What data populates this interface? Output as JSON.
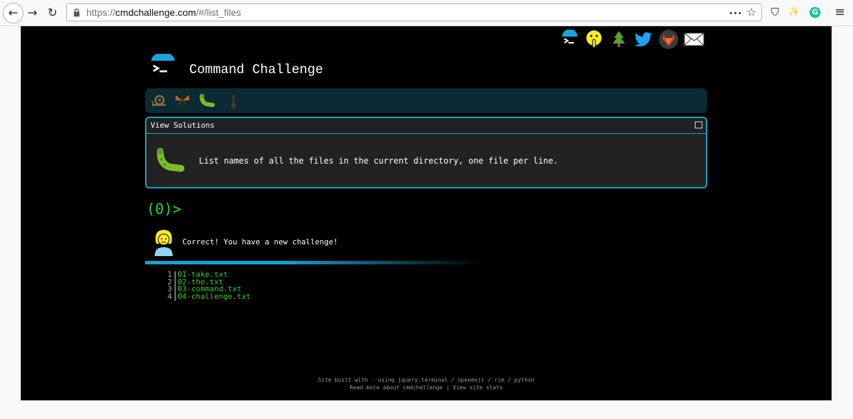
{
  "browser": {
    "url_prefix": "https://",
    "url_domain": "cmdchallenge.com",
    "url_path": "/#/list_files",
    "back_glyph": "←",
    "forward_glyph": "→",
    "reload_glyph": "↻",
    "more_glyph": "•••",
    "bookmark_glyph": "☆",
    "shield_glyph": "⛉",
    "wand_glyph": "✨",
    "grammarly_glyph": "G",
    "menu_glyph": "≡"
  },
  "header": {
    "title": "Command Challenge"
  },
  "level_icons": [
    "snail-icon",
    "butterfly-icon",
    "caterpillar-icon",
    "ant-icon"
  ],
  "panel": {
    "title": "View Solutions",
    "challenge_text": "List names of all the files in the current directory, one file per line."
  },
  "terminal": {
    "prompt": "(0)>",
    "message": "Correct! You have a new challenge!",
    "progress_fraction": 0.42,
    "output": [
      {
        "num": "1",
        "name": "01-take.txt"
      },
      {
        "num": "2",
        "name": "02-the.txt"
      },
      {
        "num": "3",
        "name": "03-command.txt"
      },
      {
        "num": "4",
        "name": "04-challenge.txt"
      }
    ]
  },
  "footer": {
    "line1": "Site built with ♡ using jquery.terminal / openmoji / rim / python",
    "line2": "Read more about cmdchallenge | View site stats"
  },
  "colors": {
    "accent": "#1aa3c9",
    "terminal_green": "#2bd42b",
    "page_bg": "#000000"
  }
}
